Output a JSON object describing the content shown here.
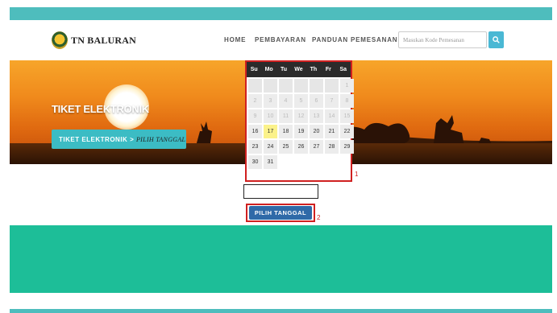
{
  "header": {
    "brand": "TN BALURAN",
    "nav": [
      "HOME",
      "PEMBAYARAN",
      "PANDUAN PEMESANAN"
    ],
    "search": {
      "placeholder": "Masukan Kode Pemesanan"
    },
    "search_icon": "search-icon"
  },
  "banner": {
    "title": "TIKET ELEKTRONIK",
    "breadcrumb": {
      "root": "TIKET ELEKTRONIK",
      "separator": " > ",
      "current": "PILIH TANGGAL"
    }
  },
  "calendar": {
    "weekdays": [
      "Su",
      "Mo",
      "Tu",
      "We",
      "Th",
      "Fr",
      "Sa"
    ],
    "rows": [
      [
        "",
        "",
        "",
        "",
        "",
        "",
        "1"
      ],
      [
        "2",
        "3",
        "4",
        "5",
        "6",
        "7",
        "8"
      ],
      [
        "9",
        "10",
        "11",
        "12",
        "13",
        "14",
        "15"
      ],
      [
        "16",
        "17",
        "18",
        "19",
        "20",
        "21",
        "22"
      ],
      [
        "23",
        "24",
        "25",
        "26",
        "27",
        "28",
        "29"
      ],
      [
        "30",
        "31",
        "",
        "",
        "",
        "",
        ""
      ]
    ],
    "highlighted_day": "17",
    "annotation": "1"
  },
  "form": {
    "date_value": "",
    "submit_label": "PILIH TANGGAL",
    "annotation": "2"
  },
  "colors": {
    "accent": "#4ebdbd",
    "green": "#1dbe98",
    "button": "#2f6aa8",
    "highlight": "#d02020"
  }
}
